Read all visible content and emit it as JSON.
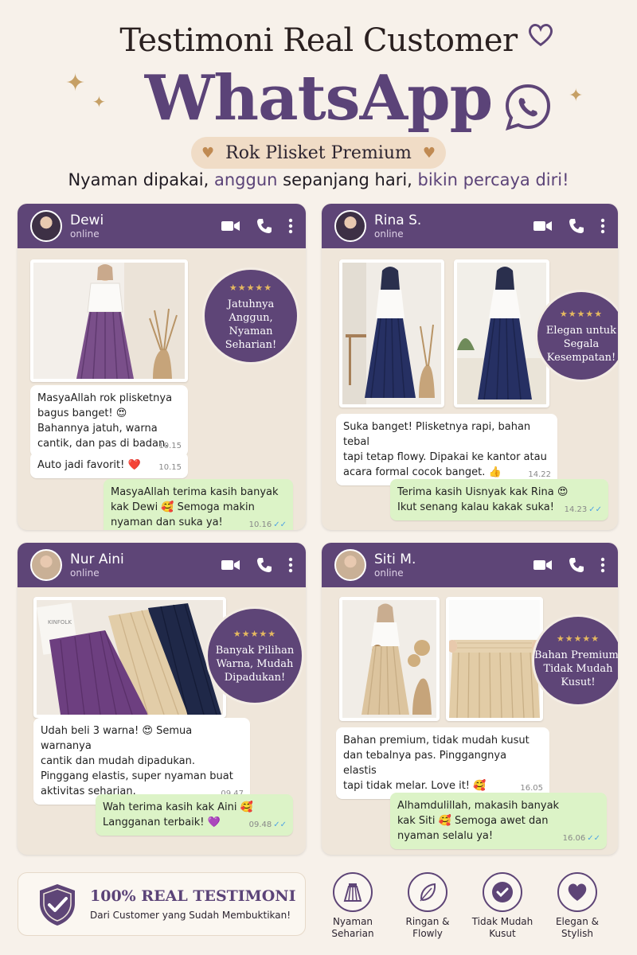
{
  "header": {
    "title_line1": "Testimoni Real Customer",
    "title_line2": "WhatsApp",
    "product": "Rok Plisket Premium",
    "tagline_a": "Nyaman dipakai, ",
    "tagline_b": "anggun",
    "tagline_c": " sepanjang hari, ",
    "tagline_d": "bikin percaya diri!",
    "icons": [
      "heart-icon",
      "whatsapp-icon",
      "sparkle-icon"
    ]
  },
  "chats": [
    {
      "name": "Dewi",
      "status": "online",
      "badge_stars": "★★★★★",
      "badge_text": [
        "Jatuhnya",
        "Anggun,",
        "Nyaman",
        "Seharian!"
      ],
      "messages": [
        {
          "dir": "in",
          "lines": [
            "MasyaAllah rok plisketnya",
            "bagus banget! 😍",
            "Bahannya jatuh, warna",
            "cantik, dan pas di badan."
          ],
          "time": "10.15"
        },
        {
          "dir": "in",
          "lines": [
            "Auto jadi favorit! ❤️"
          ],
          "time": "10.15"
        },
        {
          "dir": "out",
          "lines": [
            "MasyaAllah terima kasih banyak",
            "kak Dewi 🥰 Semoga makin",
            "nyaman dan suka ya!"
          ],
          "time": "10.16"
        }
      ]
    },
    {
      "name": "Rina S.",
      "status": "online",
      "badge_stars": "★★★★★",
      "badge_text": [
        "Elegan untuk",
        "Segala",
        "Kesempatan!"
      ],
      "messages": [
        {
          "dir": "in",
          "lines": [
            "Suka banget! Plisketnya rapi, bahan tebal",
            "tapi tetap flowy. Dipakai ke kantor atau",
            "acara formal cocok banget. 👍"
          ],
          "time": "14.22"
        },
        {
          "dir": "out",
          "lines": [
            "Terima kasih Uisnyak kak Rina 😍",
            "Ikut senang kalau kakak suka!"
          ],
          "time": "14.23"
        }
      ]
    },
    {
      "name": "Nur Aini",
      "status": "online",
      "badge_stars": "★★★★★",
      "badge_text": [
        "Banyak Pilihan",
        "Warna, Mudah",
        "Dipadukan!"
      ],
      "messages": [
        {
          "dir": "in",
          "lines": [
            "Udah beli 3 warna! 😍 Semua warnanya",
            "cantik dan mudah dipadukan.",
            "Pinggang elastis, super nyaman buat",
            "aktivitas seharian."
          ],
          "time": "09.47"
        },
        {
          "dir": "out",
          "lines": [
            "Wah terima kasih kak Aini 🥰",
            "Langganan terbaik! 💜"
          ],
          "time": "09.48"
        }
      ]
    },
    {
      "name": "Siti M.",
      "status": "online",
      "badge_stars": "★★★★★",
      "badge_text": [
        "Bahan Premium,",
        "Tidak Mudah",
        "Kusut!"
      ],
      "messages": [
        {
          "dir": "in",
          "lines": [
            "Bahan premium, tidak mudah kusut",
            "dan tebalnya pas. Pinggangnya elastis",
            "tapi tidak melar. Love it! 🥰"
          ],
          "time": "16.05"
        },
        {
          "dir": "out",
          "lines": [
            "Alhamdulillah, makasih banyak",
            "kak Siti 🥰 Semoga awet dan",
            "nyaman selalu ya!"
          ],
          "time": "16.06"
        }
      ]
    }
  ],
  "footer": {
    "title": "100% REAL TESTIMONI",
    "subtitle": "Dari Customer yang Sudah Membuktikan!",
    "features": [
      {
        "label1": "Nyaman",
        "label2": "Seharian",
        "icon": "skirt-icon"
      },
      {
        "label1": "Ringan &",
        "label2": "Flowly",
        "icon": "feather-icon"
      },
      {
        "label1": "Tidak Mudah",
        "label2": "Kusut",
        "icon": "check-icon"
      },
      {
        "label1": "Elegan &",
        "label2": "Stylish",
        "icon": "heart-icon"
      }
    ]
  },
  "photo_labels": {
    "tag_text": "KINFOLK"
  },
  "colors": {
    "accent": "#5e4577",
    "bubble_out": "#dcf3c7",
    "gold": "#c6a066"
  }
}
